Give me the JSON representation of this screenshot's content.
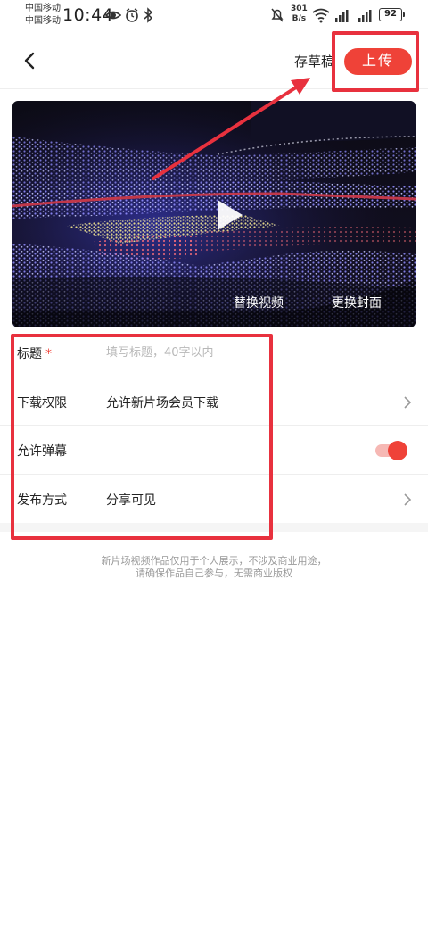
{
  "status_bar": {
    "carrier_1": "中国移动",
    "carrier_2": "中国移动",
    "time": "10:44",
    "net_speed_value": "301",
    "net_speed_unit": "B/s",
    "battery": "92"
  },
  "header": {
    "draft_label": "存草稿",
    "upload_label": "上传"
  },
  "video": {
    "replace_video_label": "替换视频",
    "change_cover_label": "更换封面"
  },
  "form": {
    "title": {
      "label": "标题",
      "required_mark": "*",
      "placeholder": "填写标题，40字以内",
      "value": ""
    },
    "download": {
      "label": "下载权限",
      "value": "允许新片场会员下载"
    },
    "danmaku": {
      "label": "允许弹幕",
      "enabled": true
    },
    "publish": {
      "label": "发布方式",
      "value": "分享可见"
    }
  },
  "footer": {
    "line_1": "新片场视频作品仅用于个人展示，不涉及商业用途，",
    "line_2": "请确保作品自己参与，无需商业版权"
  },
  "colors": {
    "accent": "#ef4238",
    "annotation": "#e8313e"
  }
}
